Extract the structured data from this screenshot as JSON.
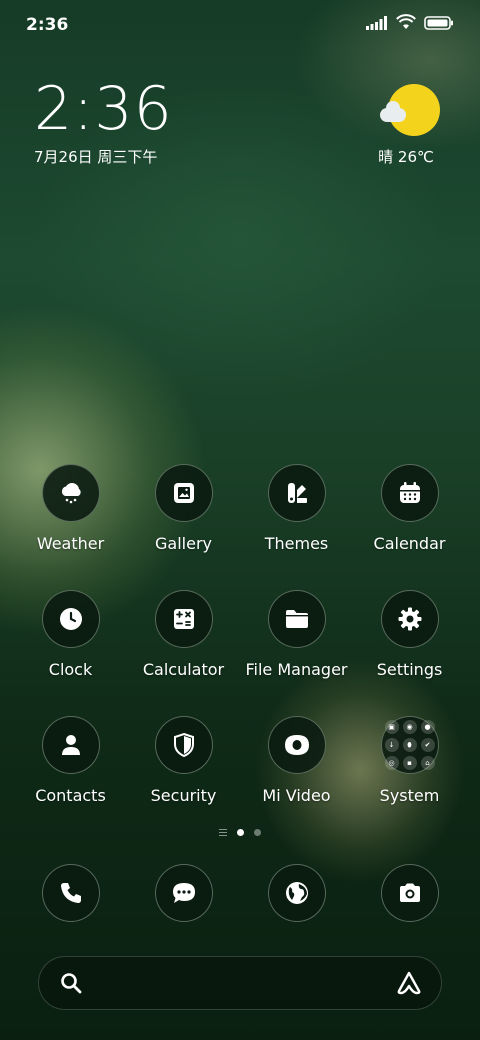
{
  "status_bar": {
    "time": "2:36",
    "signal": "signal-icon",
    "wifi": "wifi-icon",
    "battery": "battery-icon"
  },
  "clock_widget": {
    "time": "2:36",
    "date": "7月26日 周三下午"
  },
  "weather_widget": {
    "condition_icon": "sunny-cloud-icon",
    "text": "晴 26℃",
    "sun_color": "#f4d31c"
  },
  "apps": [
    {
      "label": "Weather",
      "icon": "weather-icon"
    },
    {
      "label": "Gallery",
      "icon": "gallery-icon"
    },
    {
      "label": "Themes",
      "icon": "themes-icon"
    },
    {
      "label": "Calendar",
      "icon": "calendar-icon"
    },
    {
      "label": "Clock",
      "icon": "clock-icon"
    },
    {
      "label": "Calculator",
      "icon": "calculator-icon"
    },
    {
      "label": "File Manager",
      "icon": "folder-icon"
    },
    {
      "label": "Settings",
      "icon": "gear-icon"
    },
    {
      "label": "Contacts",
      "icon": "contacts-icon"
    },
    {
      "label": "Security",
      "icon": "shield-icon"
    },
    {
      "label": "Mi Video",
      "icon": "video-icon"
    },
    {
      "label": "System",
      "icon": "folder-grid-icon"
    }
  ],
  "page_indicator": {
    "pages": 2,
    "current": 1
  },
  "dock": [
    {
      "icon": "phone-icon"
    },
    {
      "icon": "messages-icon"
    },
    {
      "icon": "browser-icon"
    },
    {
      "icon": "camera-icon"
    }
  ],
  "search_bar": {
    "left_icon": "search-icon",
    "right_icon": "assistant-icon"
  }
}
